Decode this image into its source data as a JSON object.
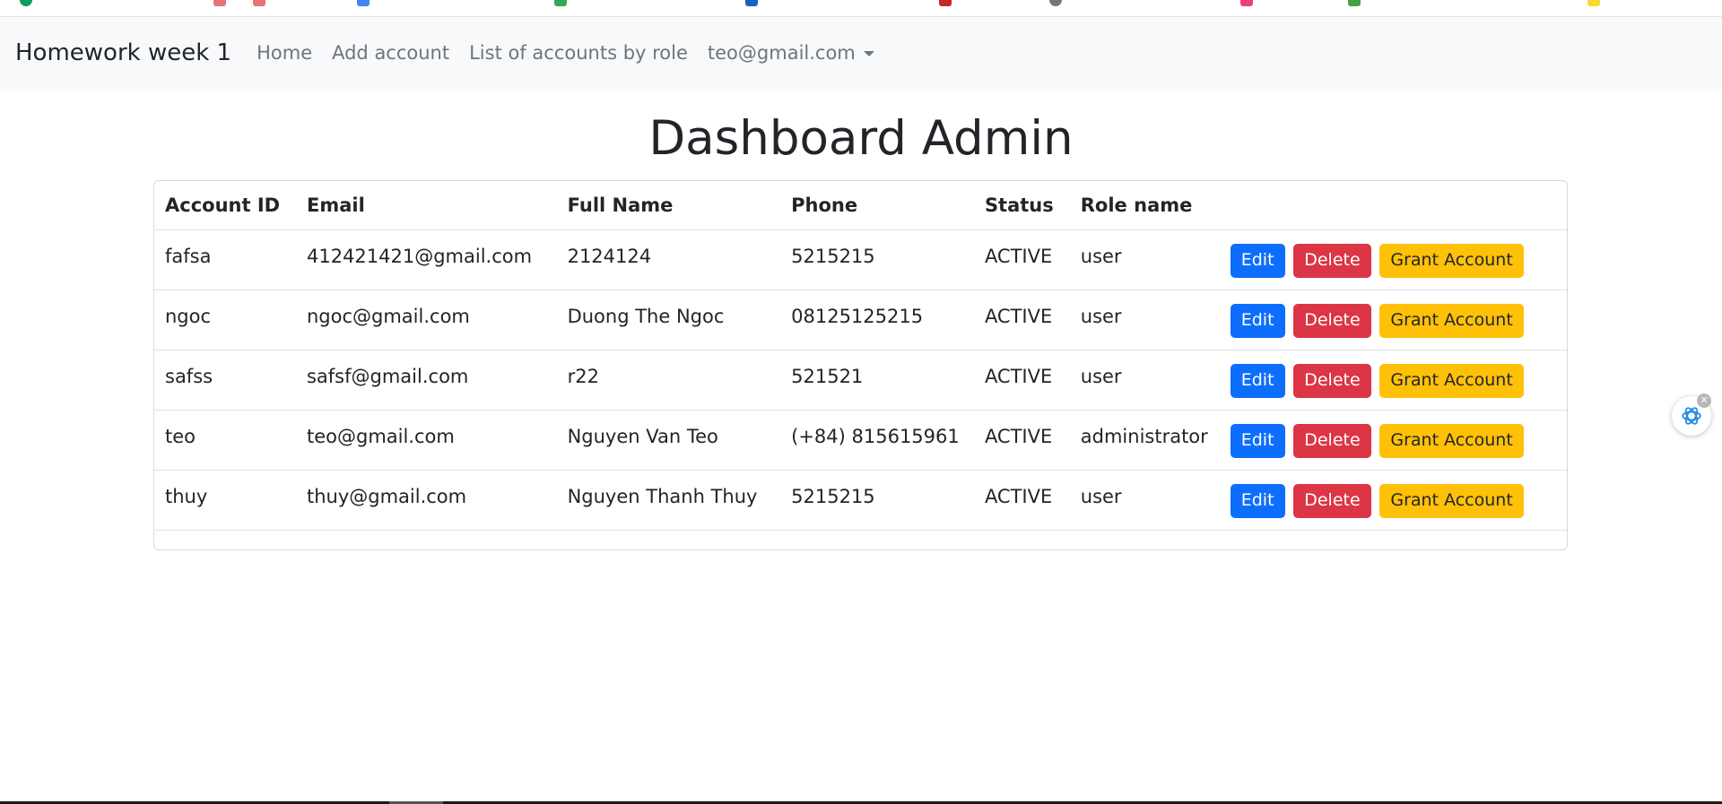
{
  "navbar": {
    "brand": "Homework week 1",
    "links": [
      "Home",
      "Add account",
      "List of accounts by role"
    ],
    "user": "teo@gmail.com"
  },
  "page_title": "Dashboard Admin",
  "table": {
    "headers": [
      "Account ID",
      "Email",
      "Full Name",
      "Phone",
      "Status",
      "Role name"
    ],
    "rows": [
      [
        "fafsa",
        "412421421@gmail.com",
        "2124124",
        "5215215",
        "ACTIVE",
        "user"
      ],
      [
        "ngoc",
        "ngoc@gmail.com",
        "Duong The Ngoc",
        "08125125215",
        "ACTIVE",
        "user"
      ],
      [
        "safss",
        "safsf@gmail.com",
        "r22",
        "521521",
        "ACTIVE",
        "user"
      ],
      [
        "teo",
        "teo@gmail.com",
        "Nguyen Van Teo",
        "(+84) 815615961",
        "ACTIVE",
        "administrator"
      ],
      [
        "thuy",
        "thuy@gmail.com",
        "Nguyen Thanh Thuy",
        "5215215",
        "ACTIVE",
        "user"
      ]
    ],
    "actions": {
      "edit": "Edit",
      "delete": "Delete",
      "grant": "Grant Account"
    }
  },
  "colors": {
    "primary": "#0d6efd",
    "danger": "#dc3545",
    "warning": "#ffc107",
    "navbar_bg": "#f8f9fa"
  },
  "icons": {
    "fab": "chatgpt-icon",
    "fab_close": "close-icon"
  }
}
